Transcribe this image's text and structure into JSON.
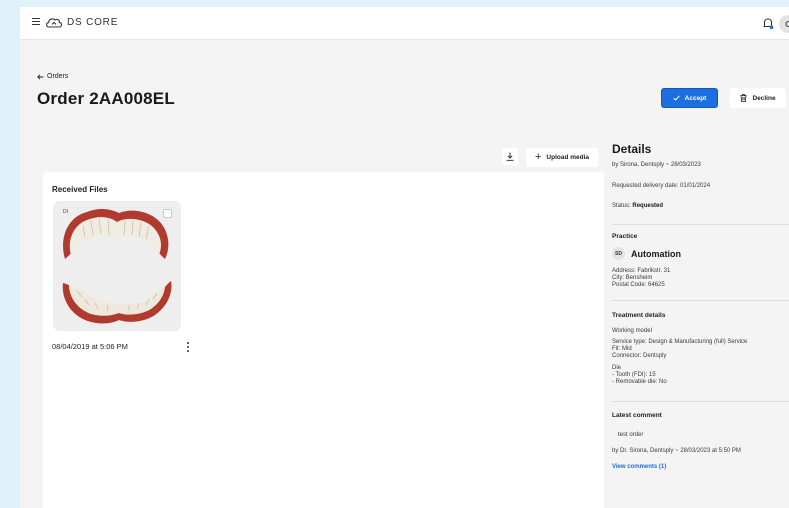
{
  "app": {
    "brand": "DS CORE",
    "avatar_initial": "C"
  },
  "page": {
    "back_label": "Orders",
    "title": "Order 2AA008EL",
    "accept_label": "Accept",
    "decline_label": "Decline",
    "upload_label": "Upload media"
  },
  "files": {
    "heading": "Received Files",
    "items": [
      {
        "tag": "DI",
        "date": "08/04/2019 at 5:06 PM"
      }
    ]
  },
  "details": {
    "title": "Details",
    "byline": "by Sirona, Dentsply ~ 28/03/2023",
    "delivery": "Requested delivery date: 01/01/2024",
    "status_label": "Status:",
    "status_value": "Requested",
    "practice_heading": "Practice",
    "practice_initials": "SD",
    "practice_name": "Automation",
    "address": "Address: Fabrikstr. 31",
    "city": "City: Bensheim",
    "postal": "Postal Code: 64625",
    "treatment_heading": "Treatment details",
    "working_model": "Working model",
    "service_type": "Service type: Design & Manufacturing (full) Service",
    "fit": "Fit: Mid",
    "connector": "Connector: Dentsply",
    "die": "Die",
    "tooth": "- Tooth (FDI): 15",
    "removable": "- Removable die: No",
    "comment_heading": "Latest comment",
    "comment_text": "test order",
    "comment_by": "by Dr. Sirona, Dentsply ~ 28/03/2023 at 5:50 PM",
    "view_comments": "View comments (1)"
  },
  "colors": {
    "accent": "#1b6fe0",
    "page_bg": "#f4f4f4",
    "frame_bg": "#dff1fb"
  },
  "icons": [
    "menu-icon",
    "ds-core-logo-icon",
    "bell-icon",
    "arrow-left-icon",
    "check-icon",
    "trash-icon",
    "download-icon",
    "plus-icon",
    "kebab-icon"
  ]
}
